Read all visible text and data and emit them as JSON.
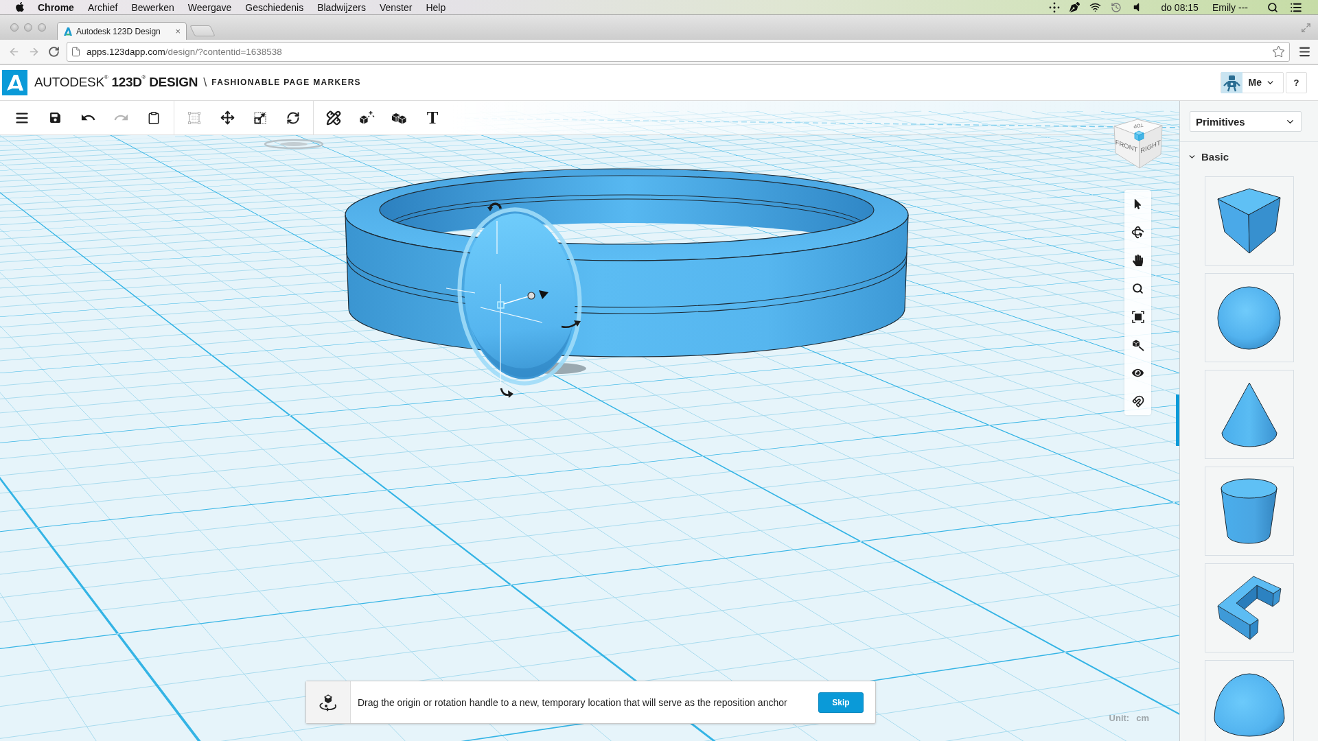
{
  "menu_bar": {
    "app_name": "Chrome",
    "menus": [
      "Archief",
      "Bewerken",
      "Weergave",
      "Geschiedenis",
      "Bladwijzers",
      "Venster",
      "Help"
    ],
    "clock": "do 08:15",
    "user": "Emily ---"
  },
  "browser": {
    "tabs": [
      {
        "title": "Autodesk 123D Design",
        "close": "×",
        "selected": true
      }
    ],
    "address": {
      "host": "apps.123dapp.com",
      "path": "/design/?contentid=1638538"
    }
  },
  "header": {
    "brand": "AUTODESK$^{®}$ **123D**$^{®}$ **DESIGN**",
    "separator": "\\",
    "project": "FASHIONABLE PAGE MARKERS",
    "user_button": "Me",
    "help_button": "?"
  },
  "toolbar": {
    "groups": [
      [
        {
          "kind": "menu",
          "disabled": false
        },
        {
          "kind": "save",
          "disabled": false
        },
        {
          "kind": "undo",
          "disabled": false
        },
        {
          "kind": "redo",
          "disabled": true
        },
        {
          "kind": "paste",
          "disabled": false
        }
      ],
      [
        {
          "kind": "tweak",
          "disabled": true
        },
        {
          "kind": "move",
          "disabled": false
        },
        {
          "kind": "scale",
          "disabled": false
        },
        {
          "kind": "rotate",
          "disabled": false
        }
      ],
      [
        {
          "kind": "construct",
          "disabled": false
        },
        {
          "kind": "modify",
          "disabled": false
        },
        {
          "kind": "combine",
          "disabled": false
        },
        {
          "kind": "text",
          "glyph": "T",
          "disabled": false
        }
      ]
    ]
  },
  "view_cube": {
    "front": "FRONT",
    "right": "RIGHT",
    "top": "TOP"
  },
  "nav_tools": [
    {
      "kind": "select"
    },
    {
      "kind": "orbit"
    },
    {
      "kind": "pan"
    },
    {
      "kind": "zoom"
    },
    {
      "kind": "fit"
    },
    {
      "kind": "zoom_selected"
    },
    {
      "kind": "visibility"
    },
    {
      "kind": "snap"
    }
  ],
  "hint": {
    "text": "Drag the origin or rotation handle to a new, temporary location that will serve as the reposition anchor",
    "button": "Skip"
  },
  "unit": {
    "label": "Unit:",
    "value": "cm"
  },
  "sidebar": {
    "dropdown": "Primitives",
    "sections": [
      {
        "title": "Basic",
        "expanded": true,
        "items": [
          {
            "kind": "box"
          },
          {
            "kind": "sphere"
          },
          {
            "kind": "cone"
          },
          {
            "kind": "cylinder"
          },
          {
            "kind": "bracket"
          },
          {
            "kind": "hemisphere"
          }
        ]
      }
    ]
  }
}
